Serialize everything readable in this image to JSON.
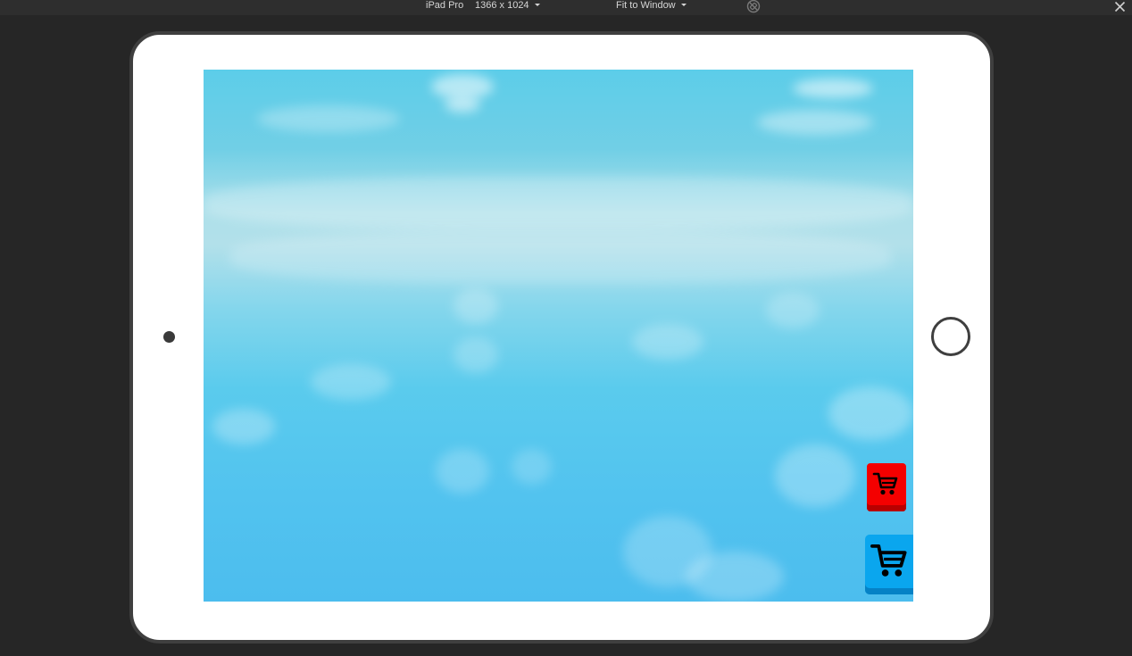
{
  "toolbar": {
    "device_name": "iPad Pro",
    "resolution": "1366 x 1024",
    "zoom_mode": "Fit to Window",
    "rotate_icon": "rotate-disabled-icon",
    "close_icon": "close-icon"
  },
  "device": {
    "home_button_icon": "home-button",
    "camera_icon": "camera-dot"
  },
  "game": {
    "buttons": [
      {
        "name": "shop-button-red",
        "icon": "cart-icon",
        "color": "#f40000"
      },
      {
        "name": "shop-button-blue",
        "icon": "cart-icon",
        "color": "#0aa6ee"
      }
    ]
  },
  "colors": {
    "topbar": "#2e2e2e",
    "background": "#262626",
    "bezel": "#3f3f3f",
    "sky": "#5ccde9"
  }
}
